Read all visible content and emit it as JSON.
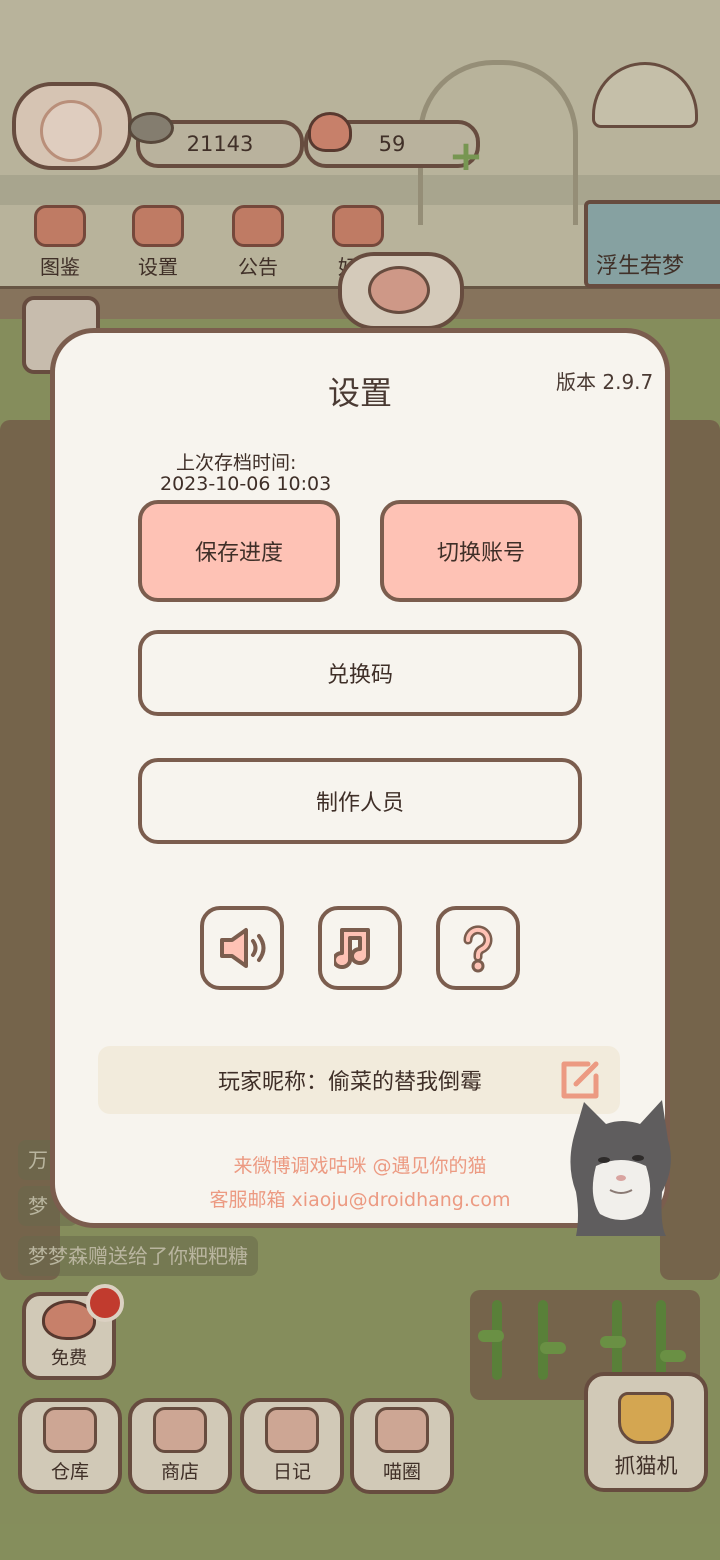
{
  "hud": {
    "fish_count": "21143",
    "heart_count": "59",
    "nav": [
      {
        "label": "图鉴",
        "icon": "cat-book-icon"
      },
      {
        "label": "设置",
        "icon": "gear-icon"
      },
      {
        "label": "公告",
        "icon": "gift-icon"
      },
      {
        "label": "好友",
        "icon": "friends-icon"
      }
    ],
    "banner_label": "浮生若梦"
  },
  "chat": {
    "rows": [
      "万",
      "梦",
      "梦梦森赠送给了你粑粑糖"
    ]
  },
  "free_button": {
    "label": "免费"
  },
  "bottom_nav": [
    {
      "label": "仓库",
      "icon": "warehouse-icon"
    },
    {
      "label": "商店",
      "icon": "shop-icon"
    },
    {
      "label": "日记",
      "icon": "diary-icon"
    },
    {
      "label": "喵圈",
      "icon": "cat-circle-icon"
    }
  ],
  "claw_machine": {
    "label": "抓猫机",
    "icon": "claw-icon"
  },
  "settings": {
    "title": "设置",
    "version": "版本 2.9.7",
    "save_time_label": "上次存档时间:",
    "save_time_value": "2023-10-06 10:03",
    "save_button": "保存进度",
    "switch_account_button": "切换账号",
    "redeem_code_button": "兑换码",
    "credits_button": "制作人员",
    "icon_buttons": [
      "speaker-icon",
      "music-note-icon",
      "question-icon"
    ],
    "nickname": "玩家昵称：偷菜的替我倒霉",
    "weibo_line": "来微博调戏咕咪 @遇见你的猫",
    "email_line": "客服邮箱 xiaoju@droidhang.com"
  },
  "colors": {
    "dialog_bg": "#f7f4ee",
    "border": "#7b5d4e",
    "pink_button": "#fec2b5",
    "footer_text": "#ec9a82"
  }
}
